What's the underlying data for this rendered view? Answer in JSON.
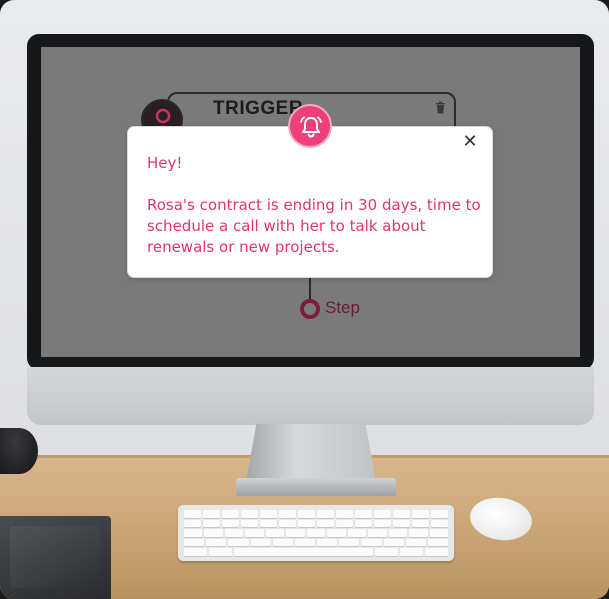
{
  "screen": {
    "trigger_card": {
      "title": "TRIGGER"
    },
    "step": {
      "label": "Step"
    }
  },
  "notification": {
    "greeting": "Hey!",
    "body": "Rosa's contract is ending in 30 days, time to schedule a call with her to talk about renewals or new projects.",
    "close_label": "✕",
    "icon": "bell-icon"
  },
  "colors": {
    "accent": "#ec3f7b",
    "text_pink": "#e8336e",
    "step_dark": "#7a1d3c"
  }
}
